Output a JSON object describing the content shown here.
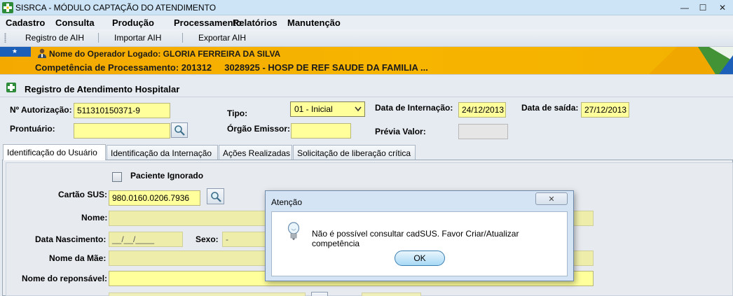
{
  "window": {
    "title": "SISRCA - MÓDULO CAPTAÇÃO DO ATENDIMENTO",
    "minimize": "—",
    "maximize": "☐",
    "close": "✕"
  },
  "menu": [
    "Cadastro",
    "Consulta",
    "Produção",
    "Processamento",
    "Relatórios",
    "Manutenção"
  ],
  "toolbar": {
    "registro": "Registro de AIH",
    "importar": "Importar AIH",
    "exportar": "Exportar AIH"
  },
  "banner": {
    "operator": "Nome do Operador Logado: GLORIA FERREIRA DA SILVA",
    "competencia": "Competência de Processamento: 201312     3028925 - HOSP DE REF SAUDE DA FAMILIA ..."
  },
  "panel": {
    "title": "Registro de Atendimento Hospitalar"
  },
  "form": {
    "autorizacao_label": "Nº Autorização:",
    "autorizacao_value": "511310150371-9",
    "tipo_label": "Tipo:",
    "tipo_value": "01 - Inicial",
    "data_internacao_label": "Data de Internação:",
    "data_internacao_value": "24/12/2013",
    "data_saida_label": "Data de saída:",
    "data_saida_value": "27/12/2013",
    "prontuario_label": "Prontuário:",
    "prontuario_value": "",
    "orgao_label": "Órgão Emissor:",
    "orgao_value": "",
    "previa_label": "Prévia Valor:",
    "previa_value": ""
  },
  "tabs": [
    "Identificação do Usuário",
    "Identificação da Internação",
    "Ações Realizadas",
    "Solicitação de liberação crítica"
  ],
  "user": {
    "ignorado_label": "Paciente Ignorado",
    "cartao_label": "Cartão SUS:",
    "cartao_value": "980.0160.0206.7936",
    "nome_label": "Nome:",
    "nascimento_label": "Data Nascimento:",
    "nascimento_value": "__/__/____",
    "sexo_label": "Sexo:",
    "sexo_value": "-",
    "mae_label": "Nome da Mãe:",
    "responsavel_label": "Nome do reponsável:"
  },
  "dialog": {
    "title": "Atenção",
    "close": "✕",
    "message": "Não é possível consultar cadSUS. Favor Criar/Atualizar competência",
    "ok": "OK"
  },
  "colors": {
    "required_field": "#ffff9c",
    "banner": "#f7b500",
    "brand_blue": "#1c5fb8"
  }
}
